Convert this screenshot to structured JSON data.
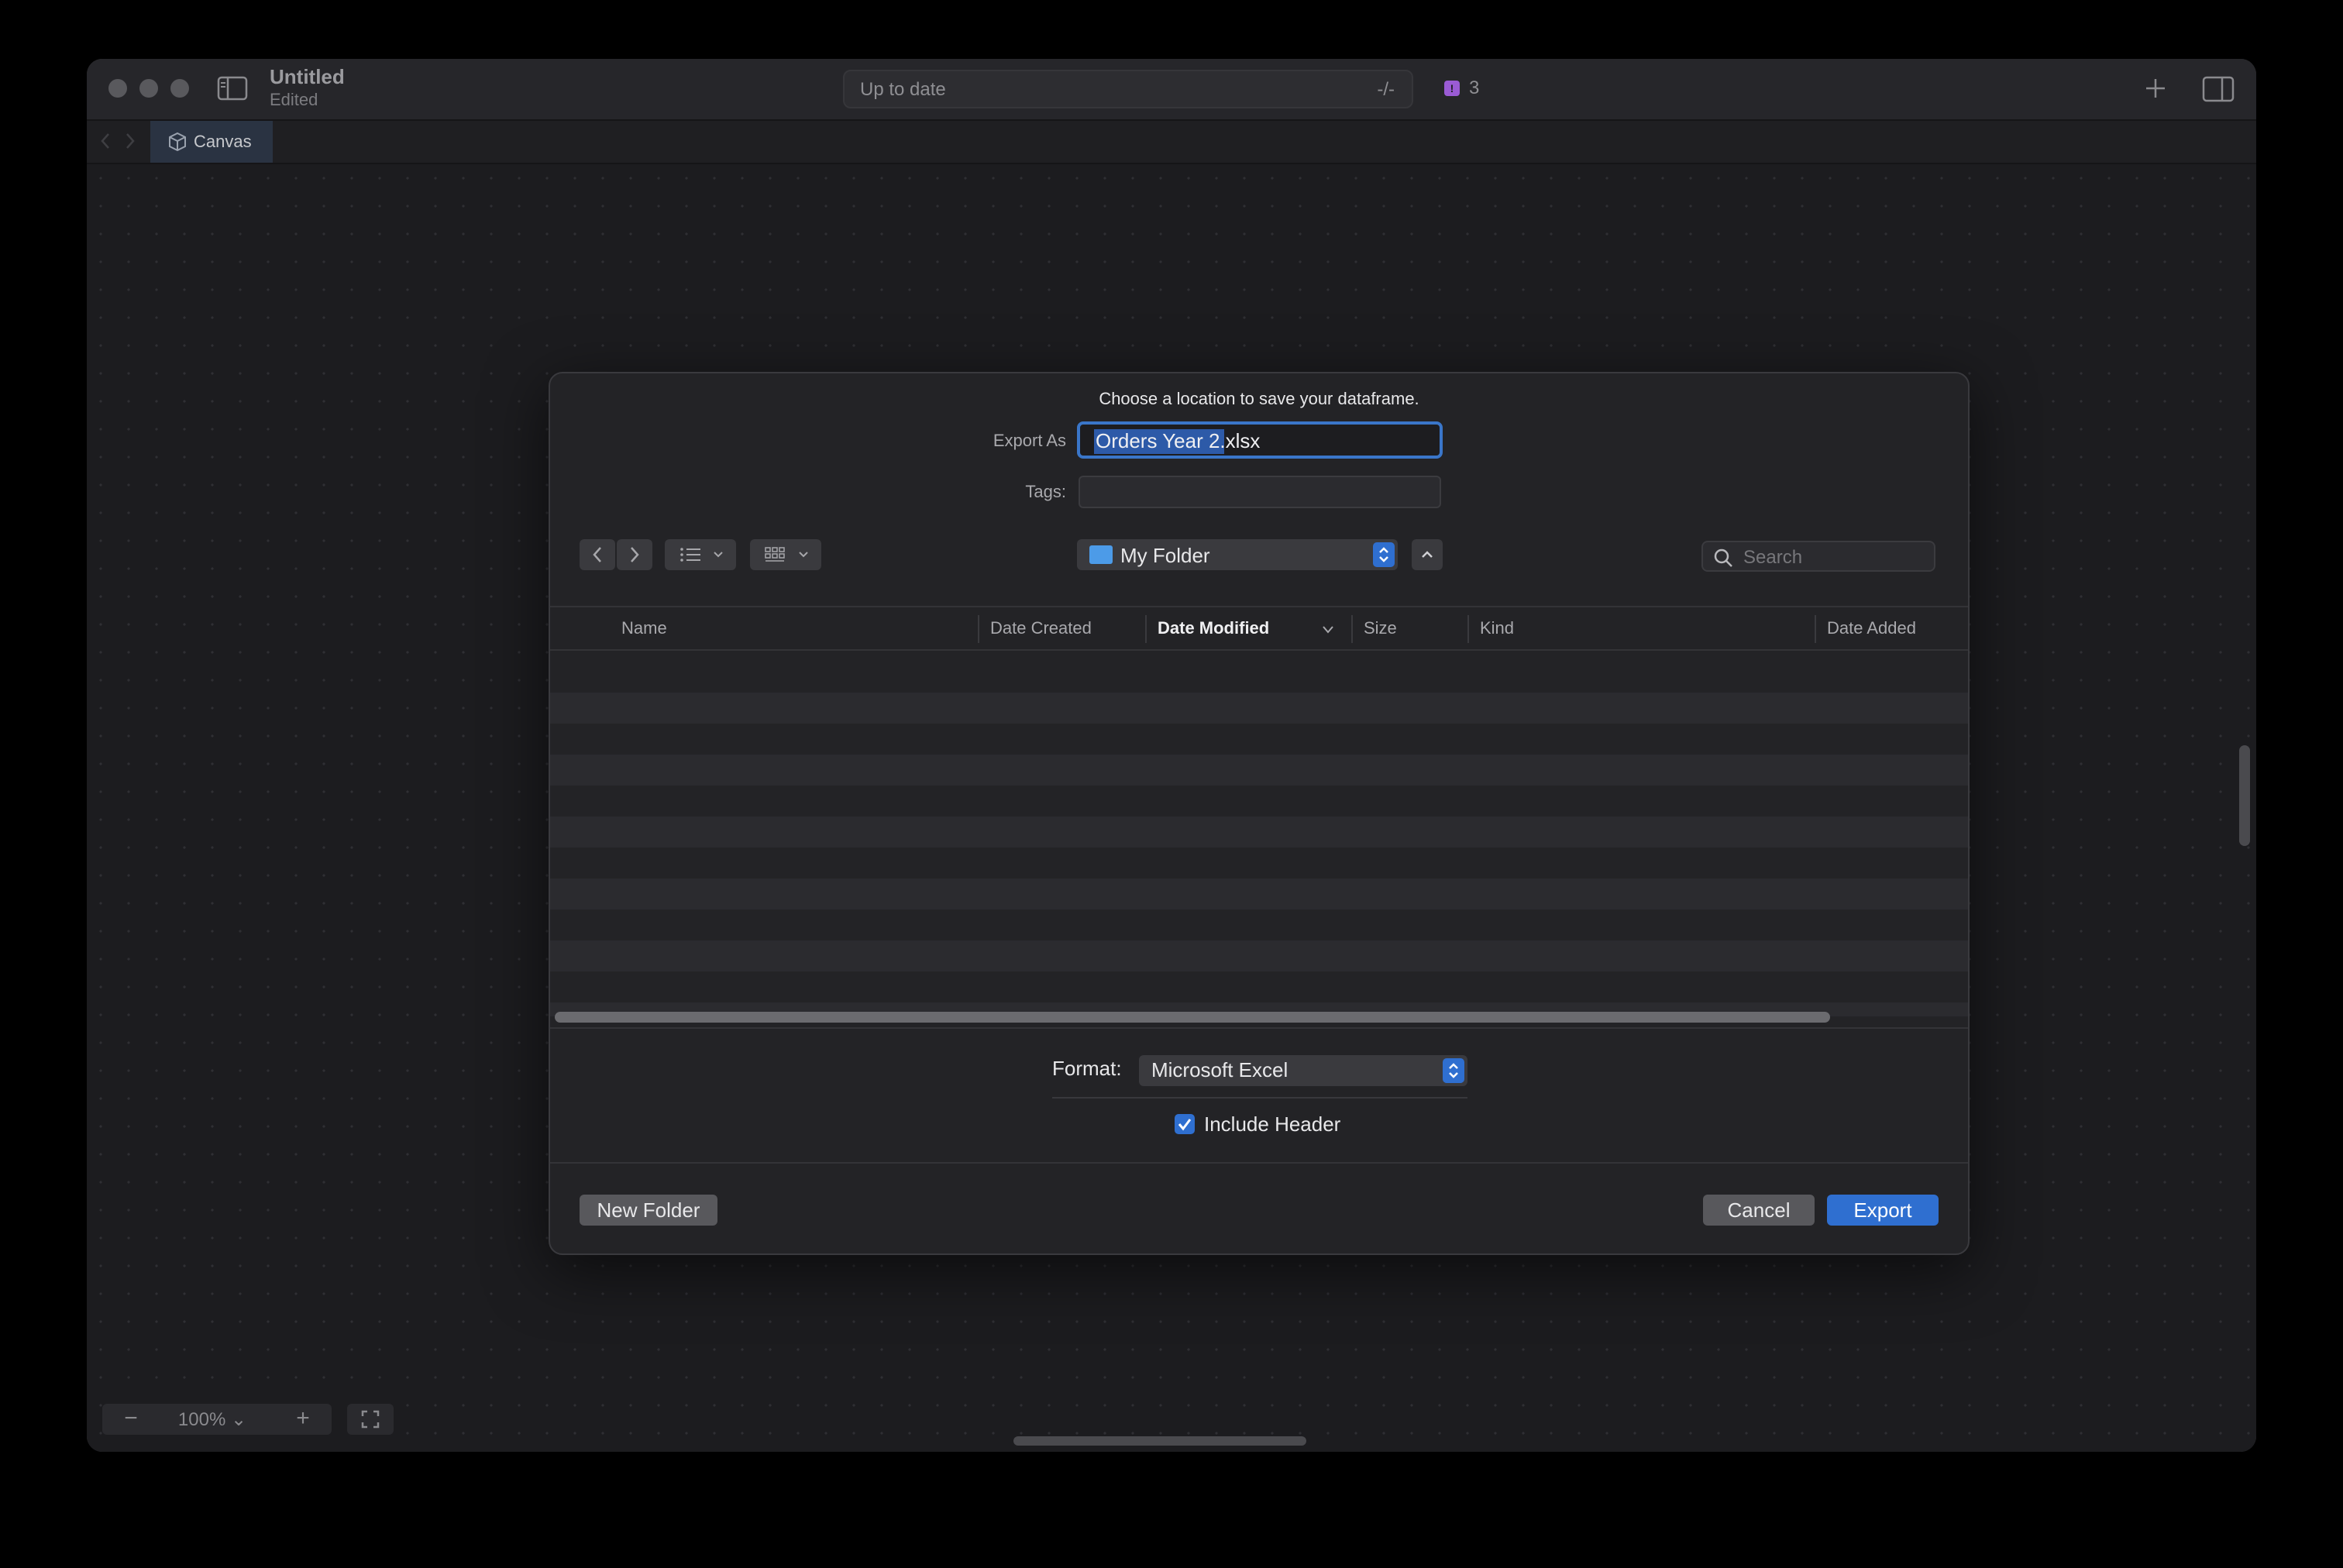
{
  "window": {
    "title": "Untitled",
    "subtitle": "Edited",
    "status": "Up to date",
    "diff": "-/-",
    "issues_count": "3"
  },
  "tabs": [
    {
      "label": "Canvas",
      "icon": "cube-icon"
    }
  ],
  "zoom": {
    "minus": "−",
    "level": "100% ⌄",
    "plus": "+"
  },
  "dialog": {
    "message": "Choose a location to save your dataframe.",
    "export_as_label": "Export As",
    "export_as_value": "Orders Year 2.xlsx",
    "tags_label": "Tags:",
    "location": "My Folder",
    "search_placeholder": "Search",
    "columns": [
      "Name",
      "Date Created",
      "Date Modified",
      "Size",
      "Kind",
      "Date Added"
    ],
    "sorted_column": "Date Modified",
    "format_label": "Format:",
    "format_value": "Microsoft Excel",
    "include_header_label": "Include Header",
    "include_header_checked": true,
    "new_folder_label": "New Folder",
    "cancel_label": "Cancel",
    "export_label": "Export"
  },
  "colors": {
    "accent": "#2f6fd0",
    "folder": "#4c9be8",
    "issue_badge": "#9a5bd4",
    "background": "#000000"
  }
}
